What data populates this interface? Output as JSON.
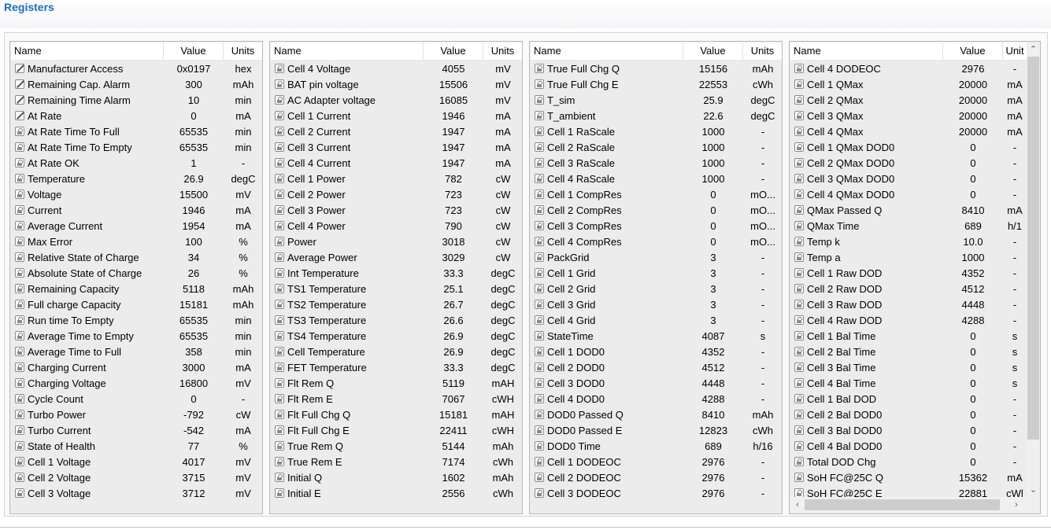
{
  "page_title": "Registers",
  "colors": {
    "title": "#1c6cb8",
    "panel_bg": "#ececec",
    "header_bg": "#ffffff"
  },
  "panels": [
    {
      "headers": {
        "name": "Name",
        "value": "Value",
        "units": "Units"
      },
      "rows": [
        {
          "name": "Manufacturer Access",
          "value": "0x0197",
          "units": "hex",
          "icon": "pencil-icon"
        },
        {
          "name": "Remaining Cap. Alarm",
          "value": "300",
          "units": "mAh",
          "icon": "pencil-icon"
        },
        {
          "name": "Remaining Time Alarm",
          "value": "10",
          "units": "min",
          "icon": "pencil-icon"
        },
        {
          "name": "At Rate",
          "value": "0",
          "units": "mA",
          "icon": "pencil-icon"
        },
        {
          "name": "At Rate Time To Full",
          "value": "65535",
          "units": "min",
          "icon": "lock-icon"
        },
        {
          "name": "At Rate Time To Empty",
          "value": "65535",
          "units": "min",
          "icon": "lock-icon"
        },
        {
          "name": "At Rate OK",
          "value": "1",
          "units": "-",
          "icon": "lock-icon"
        },
        {
          "name": "Temperature",
          "value": "26.9",
          "units": "degC",
          "icon": "lock-icon"
        },
        {
          "name": "Voltage",
          "value": "15500",
          "units": "mV",
          "icon": "lock-icon"
        },
        {
          "name": "Current",
          "value": "1946",
          "units": "mA",
          "icon": "lock-icon"
        },
        {
          "name": "Average Current",
          "value": "1954",
          "units": "mA",
          "icon": "lock-icon"
        },
        {
          "name": "Max Error",
          "value": "100",
          "units": "%",
          "icon": "lock-icon"
        },
        {
          "name": "Relative State of Charge",
          "value": "34",
          "units": "%",
          "icon": "lock-icon"
        },
        {
          "name": "Absolute State of Charge",
          "value": "26",
          "units": "%",
          "icon": "lock-icon"
        },
        {
          "name": "Remaining Capacity",
          "value": "5118",
          "units": "mAh",
          "icon": "lock-icon"
        },
        {
          "name": "Full charge Capacity",
          "value": "15181",
          "units": "mAh",
          "icon": "lock-icon"
        },
        {
          "name": "Run time To Empty",
          "value": "65535",
          "units": "min",
          "icon": "lock-icon"
        },
        {
          "name": "Average Time to Empty",
          "value": "65535",
          "units": "min",
          "icon": "lock-icon"
        },
        {
          "name": "Average Time to Full",
          "value": "358",
          "units": "min",
          "icon": "lock-icon"
        },
        {
          "name": "Charging Current",
          "value": "3000",
          "units": "mA",
          "icon": "lock-icon"
        },
        {
          "name": "Charging Voltage",
          "value": "16800",
          "units": "mV",
          "icon": "lock-icon"
        },
        {
          "name": "Cycle Count",
          "value": "0",
          "units": "-",
          "icon": "lock-icon"
        },
        {
          "name": "Turbo Power",
          "value": "-792",
          "units": "cW",
          "icon": "lock-icon"
        },
        {
          "name": "Turbo Current",
          "value": "-542",
          "units": "mA",
          "icon": "lock-icon"
        },
        {
          "name": "State of Health",
          "value": "77",
          "units": "%",
          "icon": "lock-icon"
        },
        {
          "name": "Cell 1 Voltage",
          "value": "4017",
          "units": "mV",
          "icon": "lock-icon"
        },
        {
          "name": "Cell 2 Voltage",
          "value": "3715",
          "units": "mV",
          "icon": "lock-icon"
        },
        {
          "name": "Cell 3 Voltage",
          "value": "3712",
          "units": "mV",
          "icon": "lock-icon"
        }
      ]
    },
    {
      "headers": {
        "name": "Name",
        "value": "Value",
        "units": "Units"
      },
      "rows": [
        {
          "name": "Cell 4 Voltage",
          "value": "4055",
          "units": "mV",
          "icon": "lock-icon"
        },
        {
          "name": "BAT pin voltage",
          "value": "15506",
          "units": "mV",
          "icon": "lock-icon"
        },
        {
          "name": "AC Adapter voltage",
          "value": "16085",
          "units": "mV",
          "icon": "lock-icon"
        },
        {
          "name": "Cell 1 Current",
          "value": "1946",
          "units": "mA",
          "icon": "lock-icon"
        },
        {
          "name": "Cell 2 Current",
          "value": "1947",
          "units": "mA",
          "icon": "lock-icon"
        },
        {
          "name": "Cell 3 Current",
          "value": "1947",
          "units": "mA",
          "icon": "lock-icon"
        },
        {
          "name": "Cell 4 Current",
          "value": "1947",
          "units": "mA",
          "icon": "lock-icon"
        },
        {
          "name": "Cell 1 Power",
          "value": "782",
          "units": "cW",
          "icon": "lock-icon"
        },
        {
          "name": "Cell 2 Power",
          "value": "723",
          "units": "cW",
          "icon": "lock-icon"
        },
        {
          "name": "Cell 3 Power",
          "value": "723",
          "units": "cW",
          "icon": "lock-icon"
        },
        {
          "name": "Cell 4 Power",
          "value": "790",
          "units": "cW",
          "icon": "lock-icon"
        },
        {
          "name": "Power",
          "value": "3018",
          "units": "cW",
          "icon": "lock-icon"
        },
        {
          "name": "Average Power",
          "value": "3029",
          "units": "cW",
          "icon": "lock-icon"
        },
        {
          "name": "Int Temperature",
          "value": "33.3",
          "units": "degC",
          "icon": "lock-icon"
        },
        {
          "name": "TS1 Temperature",
          "value": "25.1",
          "units": "degC",
          "icon": "lock-icon"
        },
        {
          "name": "TS2 Temperature",
          "value": "26.7",
          "units": "degC",
          "icon": "lock-icon"
        },
        {
          "name": "TS3 Temperature",
          "value": "26.6",
          "units": "degC",
          "icon": "lock-icon"
        },
        {
          "name": "TS4 Temperature",
          "value": "26.9",
          "units": "degC",
          "icon": "lock-icon"
        },
        {
          "name": "Cell Temperature",
          "value": "26.9",
          "units": "degC",
          "icon": "lock-icon"
        },
        {
          "name": "FET Temperature",
          "value": "33.3",
          "units": "degC",
          "icon": "lock-icon"
        },
        {
          "name": "Flt Rem Q",
          "value": "5119",
          "units": "mAH",
          "icon": "lock-icon"
        },
        {
          "name": "Flt Rem E",
          "value": "7067",
          "units": "cWH",
          "icon": "lock-icon"
        },
        {
          "name": "Flt Full Chg Q",
          "value": "15181",
          "units": "mAH",
          "icon": "lock-icon"
        },
        {
          "name": "Flt Full Chg E",
          "value": "22411",
          "units": "cWH",
          "icon": "lock-icon"
        },
        {
          "name": "True Rem Q",
          "value": "5144",
          "units": "mAh",
          "icon": "lock-icon"
        },
        {
          "name": "True Rem E",
          "value": "7174",
          "units": "cWh",
          "icon": "lock-icon"
        },
        {
          "name": "Initial Q",
          "value": "1602",
          "units": "mAh",
          "icon": "lock-icon"
        },
        {
          "name": "Initial E",
          "value": "2556",
          "units": "cWh",
          "icon": "lock-icon"
        }
      ]
    },
    {
      "headers": {
        "name": "Name",
        "value": "Value",
        "units": "Units"
      },
      "rows": [
        {
          "name": "True Full Chg Q",
          "value": "15156",
          "units": "mAh",
          "icon": "lock-icon"
        },
        {
          "name": "True Full Chg E",
          "value": "22553",
          "units": "cWh",
          "icon": "lock-icon"
        },
        {
          "name": "T_sim",
          "value": "25.9",
          "units": "degC",
          "icon": "lock-icon"
        },
        {
          "name": "T_ambient",
          "value": "22.6",
          "units": "degC",
          "icon": "lock-icon"
        },
        {
          "name": "Cell 1 RaScale",
          "value": "1000",
          "units": "-",
          "icon": "lock-icon"
        },
        {
          "name": "Cell 2 RaScale",
          "value": "1000",
          "units": "-",
          "icon": "lock-icon"
        },
        {
          "name": "Cell 3 RaScale",
          "value": "1000",
          "units": "-",
          "icon": "lock-icon"
        },
        {
          "name": "Cell 4 RaScale",
          "value": "1000",
          "units": "-",
          "icon": "lock-icon"
        },
        {
          "name": "Cell 1 CompRes",
          "value": "0",
          "units": "mO...",
          "icon": "lock-icon"
        },
        {
          "name": "Cell 2 CompRes",
          "value": "0",
          "units": "mO...",
          "icon": "lock-icon"
        },
        {
          "name": "Cell 3 CompRes",
          "value": "0",
          "units": "mO...",
          "icon": "lock-icon"
        },
        {
          "name": "Cell 4 CompRes",
          "value": "0",
          "units": "mO...",
          "icon": "lock-icon"
        },
        {
          "name": "PackGrid",
          "value": "3",
          "units": "-",
          "icon": "lock-icon"
        },
        {
          "name": "Cell 1 Grid",
          "value": "3",
          "units": "-",
          "icon": "lock-icon"
        },
        {
          "name": "Cell 2 Grid",
          "value": "3",
          "units": "-",
          "icon": "lock-icon"
        },
        {
          "name": "Cell 3 Grid",
          "value": "3",
          "units": "-",
          "icon": "lock-icon"
        },
        {
          "name": "Cell 4 Grid",
          "value": "3",
          "units": "-",
          "icon": "lock-icon"
        },
        {
          "name": "StateTime",
          "value": "4087",
          "units": "s",
          "icon": "lock-icon"
        },
        {
          "name": "Cell 1 DOD0",
          "value": "4352",
          "units": "-",
          "icon": "lock-icon"
        },
        {
          "name": "Cell 2 DOD0",
          "value": "4512",
          "units": "-",
          "icon": "lock-icon"
        },
        {
          "name": "Cell 3 DOD0",
          "value": "4448",
          "units": "-",
          "icon": "lock-icon"
        },
        {
          "name": "Cell 4 DOD0",
          "value": "4288",
          "units": "-",
          "icon": "lock-icon"
        },
        {
          "name": "DOD0 Passed Q",
          "value": "8410",
          "units": "mAh",
          "icon": "lock-icon"
        },
        {
          "name": "DOD0 Passed E",
          "value": "12823",
          "units": "cWh",
          "icon": "lock-icon"
        },
        {
          "name": "DOD0 Time",
          "value": "689",
          "units": "h/16",
          "icon": "lock-icon"
        },
        {
          "name": "Cell 1 DODEOC",
          "value": "2976",
          "units": "-",
          "icon": "lock-icon"
        },
        {
          "name": "Cell 2 DODEOC",
          "value": "2976",
          "units": "-",
          "icon": "lock-icon"
        },
        {
          "name": "Cell 3 DODEOC",
          "value": "2976",
          "units": "-",
          "icon": "lock-icon"
        }
      ]
    },
    {
      "headers": {
        "name": "Name",
        "value": "Value",
        "units": "Unit"
      },
      "rows": [
        {
          "name": "Cell 4 DODEOC",
          "value": "2976",
          "units": "-",
          "icon": "lock-icon"
        },
        {
          "name": "Cell 1 QMax",
          "value": "20000",
          "units": "mA",
          "icon": "lock-icon"
        },
        {
          "name": "Cell 2 QMax",
          "value": "20000",
          "units": "mA",
          "icon": "lock-icon"
        },
        {
          "name": "Cell 3 QMax",
          "value": "20000",
          "units": "mA",
          "icon": "lock-icon"
        },
        {
          "name": "Cell 4 QMax",
          "value": "20000",
          "units": "mA",
          "icon": "lock-icon"
        },
        {
          "name": "Cell 1 QMax DOD0",
          "value": "0",
          "units": "-",
          "icon": "lock-icon"
        },
        {
          "name": "Cell 2 QMax DOD0",
          "value": "0",
          "units": "-",
          "icon": "lock-icon"
        },
        {
          "name": "Cell 3 QMax DOD0",
          "value": "0",
          "units": "-",
          "icon": "lock-icon"
        },
        {
          "name": "Cell 4 QMax DOD0",
          "value": "0",
          "units": "-",
          "icon": "lock-icon"
        },
        {
          "name": "QMax Passed Q",
          "value": "8410",
          "units": "mA",
          "icon": "lock-icon"
        },
        {
          "name": "QMax Time",
          "value": "689",
          "units": "h/1",
          "icon": "lock-icon"
        },
        {
          "name": "Temp k",
          "value": "10.0",
          "units": "-",
          "icon": "lock-icon"
        },
        {
          "name": "Temp a",
          "value": "1000",
          "units": "-",
          "icon": "lock-icon"
        },
        {
          "name": "Cell 1 Raw DOD",
          "value": "4352",
          "units": "-",
          "icon": "lock-icon"
        },
        {
          "name": "Cell 2 Raw DOD",
          "value": "4512",
          "units": "-",
          "icon": "lock-icon"
        },
        {
          "name": "Cell 3 Raw DOD",
          "value": "4448",
          "units": "-",
          "icon": "lock-icon"
        },
        {
          "name": "Cell 4 Raw DOD",
          "value": "4288",
          "units": "-",
          "icon": "lock-icon"
        },
        {
          "name": "Cell 1 Bal Time",
          "value": "0",
          "units": "s",
          "icon": "lock-icon"
        },
        {
          "name": "Cell 2 Bal Time",
          "value": "0",
          "units": "s",
          "icon": "lock-icon"
        },
        {
          "name": "Cell 3 Bal Time",
          "value": "0",
          "units": "s",
          "icon": "lock-icon"
        },
        {
          "name": "Cell 4 Bal Time",
          "value": "0",
          "units": "s",
          "icon": "lock-icon"
        },
        {
          "name": "Cell 1 Bal DOD",
          "value": "0",
          "units": "-",
          "icon": "lock-icon"
        },
        {
          "name": "Cell 2 Bal DOD0",
          "value": "0",
          "units": "-",
          "icon": "lock-icon"
        },
        {
          "name": "Cell 3 Bal DOD0",
          "value": "0",
          "units": "-",
          "icon": "lock-icon"
        },
        {
          "name": "Cell 4 Bal DOD0",
          "value": "0",
          "units": "-",
          "icon": "lock-icon"
        },
        {
          "name": "Total DOD Chg",
          "value": "0",
          "units": "-",
          "icon": "lock-icon"
        },
        {
          "name": "SoH FC@25C Q",
          "value": "15362",
          "units": "mA",
          "icon": "lock-icon"
        },
        {
          "name": "SoH FC@25C E",
          "value": "22881",
          "units": "cWl",
          "icon": "lock-icon"
        }
      ]
    }
  ],
  "scrollbar": {
    "up": "⌃",
    "down": "⌄",
    "left": "‹",
    "right": "›"
  }
}
